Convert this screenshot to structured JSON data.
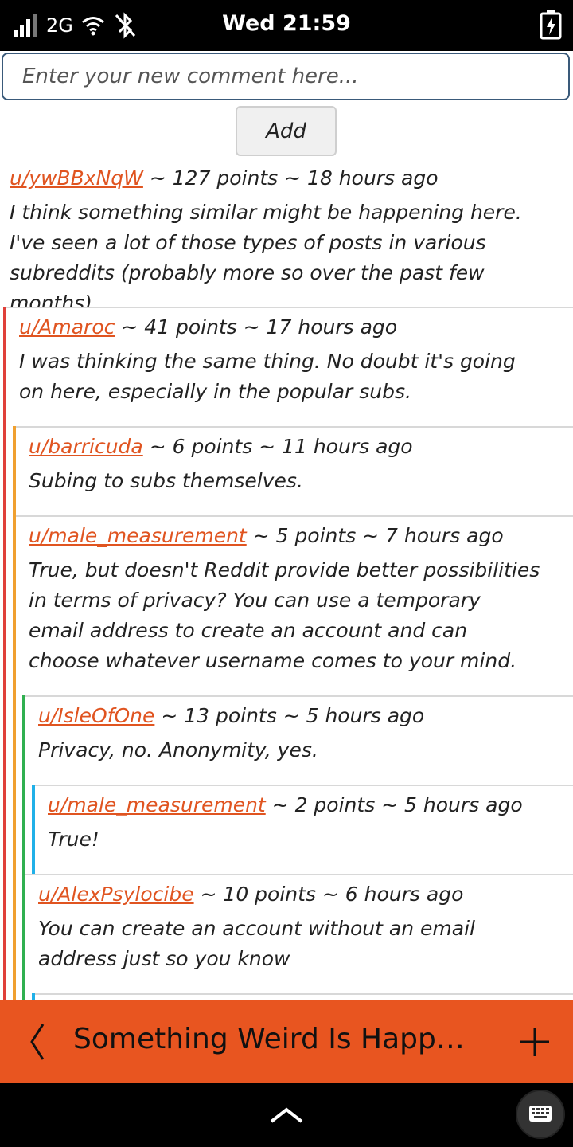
{
  "status_bar": {
    "network": "2G",
    "time": "Wed 21:59",
    "icons": [
      "signal-icon",
      "wifi-icon",
      "bluetooth-off-icon",
      "battery-charging-icon"
    ]
  },
  "composer": {
    "placeholder": "Enter your new comment here...",
    "value": "",
    "add_label": "Add"
  },
  "comments": [
    {
      "author": "u/ywBBxNqW",
      "meta": "~ 127 points ~ 18 hours ago",
      "body": "I think something similar might be happening here. I've seen a lot of those types of posts in various subreddits (probably more so over the past few months).",
      "depth": 0
    },
    {
      "author": "u/Amaroc",
      "meta": "~ 41 points ~ 17 hours ago",
      "body": "I was thinking the same thing. No doubt it's going on here, especially in the popular subs.",
      "depth": 1
    },
    {
      "author": "u/barricuda",
      "meta": "~ 6 points ~ 11 hours ago",
      "body": "Subing to subs themselves.",
      "depth": 2
    },
    {
      "author": "u/male_measurement",
      "meta": "~ 5 points ~ 7 hours ago",
      "body": "True, but doesn't Reddit provide better possibilities in terms of privacy? You can use a temporary email address to create an account and can choose whatever username comes to your mind.",
      "depth": 2
    },
    {
      "author": "u/IsleOfOne",
      "meta": "~ 13 points ~ 5 hours ago",
      "body": "Privacy, no. Anonymity, yes.",
      "depth": 3
    },
    {
      "author": "u/male_measurement",
      "meta": "~ 2 points ~ 5 hours ago",
      "body": "True!",
      "depth": 4
    },
    {
      "author": "u/AlexPsylocibe",
      "meta": "~ 10 points ~ 6 hours ago",
      "body": "You can create an account without an email address just so you know",
      "depth": 3
    }
  ],
  "depth_colors": {
    "1": "#e0403a",
    "2": "#f0a030",
    "3": "#30b050",
    "4": "#20b0e8"
  },
  "bottom_bar": {
    "title": "Something Weird Is Happening Here",
    "accent": "#e85520",
    "back_icon": "chevron-left-icon",
    "add_icon": "plus-icon"
  },
  "nav_bar": {
    "icons": [
      "chevron-up-icon",
      "keyboard-icon"
    ]
  }
}
